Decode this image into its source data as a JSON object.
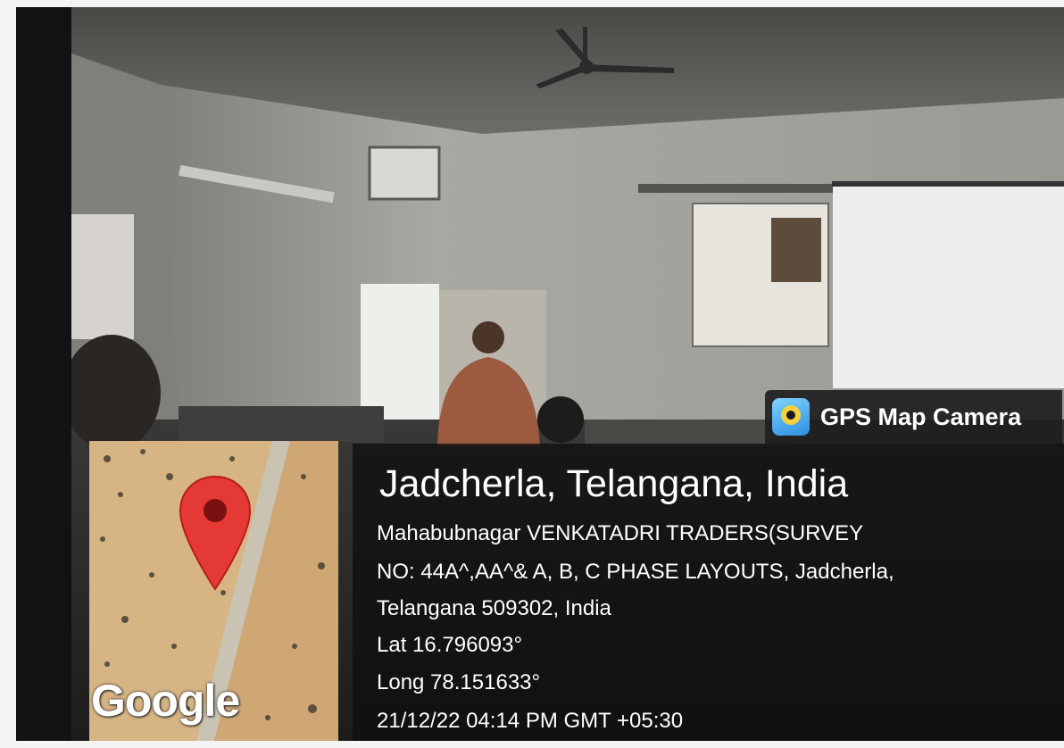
{
  "badge": {
    "app_name": "GPS Map Camera",
    "icon": "map-pin-app-icon"
  },
  "location": {
    "title": "Jadcherla, Telangana, India",
    "address_lines": [
      "Mahabubnagar VENKATADRI TRADERS(SURVEY",
      "NO: 44A^,AA^& A, B, C PHASE LAYOUTS, Jadcherla,",
      "Telangana 509302, India"
    ],
    "lat": "Lat 16.796093°",
    "long": "Long 78.151633°",
    "datetime": "21/12/22 04:14 PM GMT +05:30"
  },
  "map": {
    "logo_text": "Google",
    "pin_color": "#e53935"
  },
  "colors": {
    "overlay": "#0e0e0e",
    "text": "#ffffff"
  }
}
